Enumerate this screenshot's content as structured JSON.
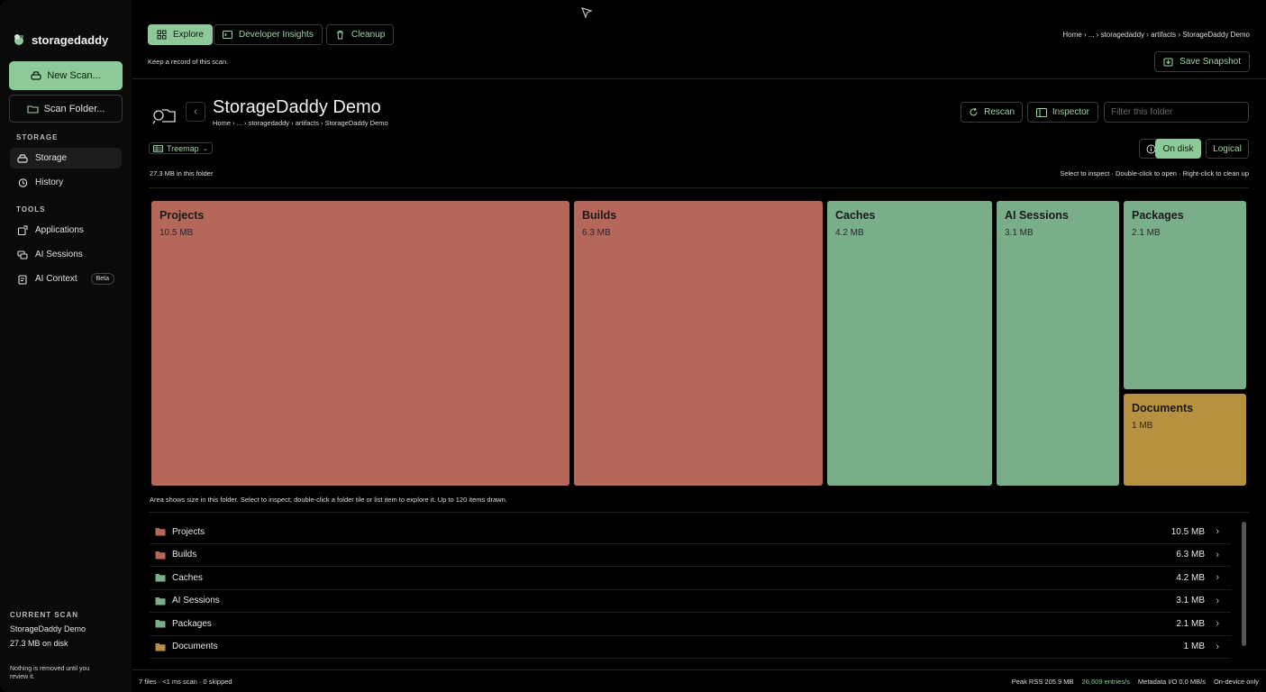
{
  "app": {
    "name": "storagedaddy"
  },
  "sidebar": {
    "new_scan": "New Scan...",
    "scan_folder": "Scan Folder...",
    "storage_label": "STORAGE",
    "storage_items": [
      {
        "label": "Storage",
        "icon": "drive-icon",
        "active": true
      },
      {
        "label": "History",
        "icon": "history-icon",
        "active": false
      }
    ],
    "tools_label": "TOOLS",
    "tool_items": [
      {
        "label": "Applications",
        "icon": "applications-icon"
      },
      {
        "label": "AI Sessions",
        "icon": "ai-sessions-icon"
      },
      {
        "label": "AI Context",
        "icon": "ai-context-icon",
        "badge": "Beta"
      }
    ],
    "current_scan_label": "CURRENT SCAN",
    "current_scan_name": "StorageDaddy Demo",
    "current_scan_size": "27.3 MB on disk",
    "note": "Nothing is removed until you review it."
  },
  "topbar": {
    "tabs": [
      {
        "label": "Explore",
        "icon": "grid-icon",
        "active": true
      },
      {
        "label": "Developer Insights",
        "icon": "terminal-icon",
        "active": false
      },
      {
        "label": "Cleanup",
        "icon": "trash-icon",
        "active": false
      }
    ],
    "breadcrumb": "Home › ... › storagedaddy › artifacts › StorageDaddy Demo",
    "record_note": "Keep a record of this scan.",
    "save_snapshot": "Save Snapshot"
  },
  "folder": {
    "title": "StorageDaddy Demo",
    "breadcrumb": "Home › ... › storagedaddy › artifacts › StorageDaddy Demo",
    "rescan": "Rescan",
    "inspector": "Inspector",
    "filter_placeholder": "Filter this folder",
    "view_mode": "Treemap",
    "size_summary": "27.3 MB in this folder",
    "hint": "Select to inspect · Double-click to open · Right-click to clean up",
    "mode_on_disk": "On disk",
    "mode_logical": "Logical"
  },
  "colors": {
    "red": "#b5675a",
    "green": "#7aad8a",
    "amber": "#b6913f",
    "accent": "#8ec99a"
  },
  "treemap": {
    "note": "Area shows size in this folder. Select to inspect; double-click a folder tile or list item to explore it. Up to 120 items drawn.",
    "tiles": [
      {
        "name": "Projects",
        "size": "10.5 MB",
        "color": "red"
      },
      {
        "name": "Builds",
        "size": "6.3 MB",
        "color": "red"
      },
      {
        "name": "Caches",
        "size": "4.2 MB",
        "color": "green"
      },
      {
        "name": "AI Sessions",
        "size": "3.1 MB",
        "color": "green"
      },
      {
        "name": "Packages",
        "size": "2.1 MB",
        "color": "green"
      },
      {
        "name": "Documents",
        "size": "1 MB",
        "color": "amber"
      }
    ]
  },
  "list": [
    {
      "name": "Projects",
      "size": "10.5 MB",
      "color": "red"
    },
    {
      "name": "Builds",
      "size": "6.3 MB",
      "color": "red"
    },
    {
      "name": "Caches",
      "size": "4.2 MB",
      "color": "green"
    },
    {
      "name": "AI Sessions",
      "size": "3.1 MB",
      "color": "green"
    },
    {
      "name": "Packages",
      "size": "2.1 MB",
      "color": "green"
    },
    {
      "name": "Documents",
      "size": "1 MB",
      "color": "amber"
    }
  ],
  "status": {
    "left": "7 files · <1 ms scan · 0 skipped",
    "peak_rss": "Peak RSS 205.9 MB",
    "entries_rate": "26,609 entries/s",
    "metadata_io": "Metadata I/O 0.0 MB/s",
    "mode": "On-device only"
  }
}
